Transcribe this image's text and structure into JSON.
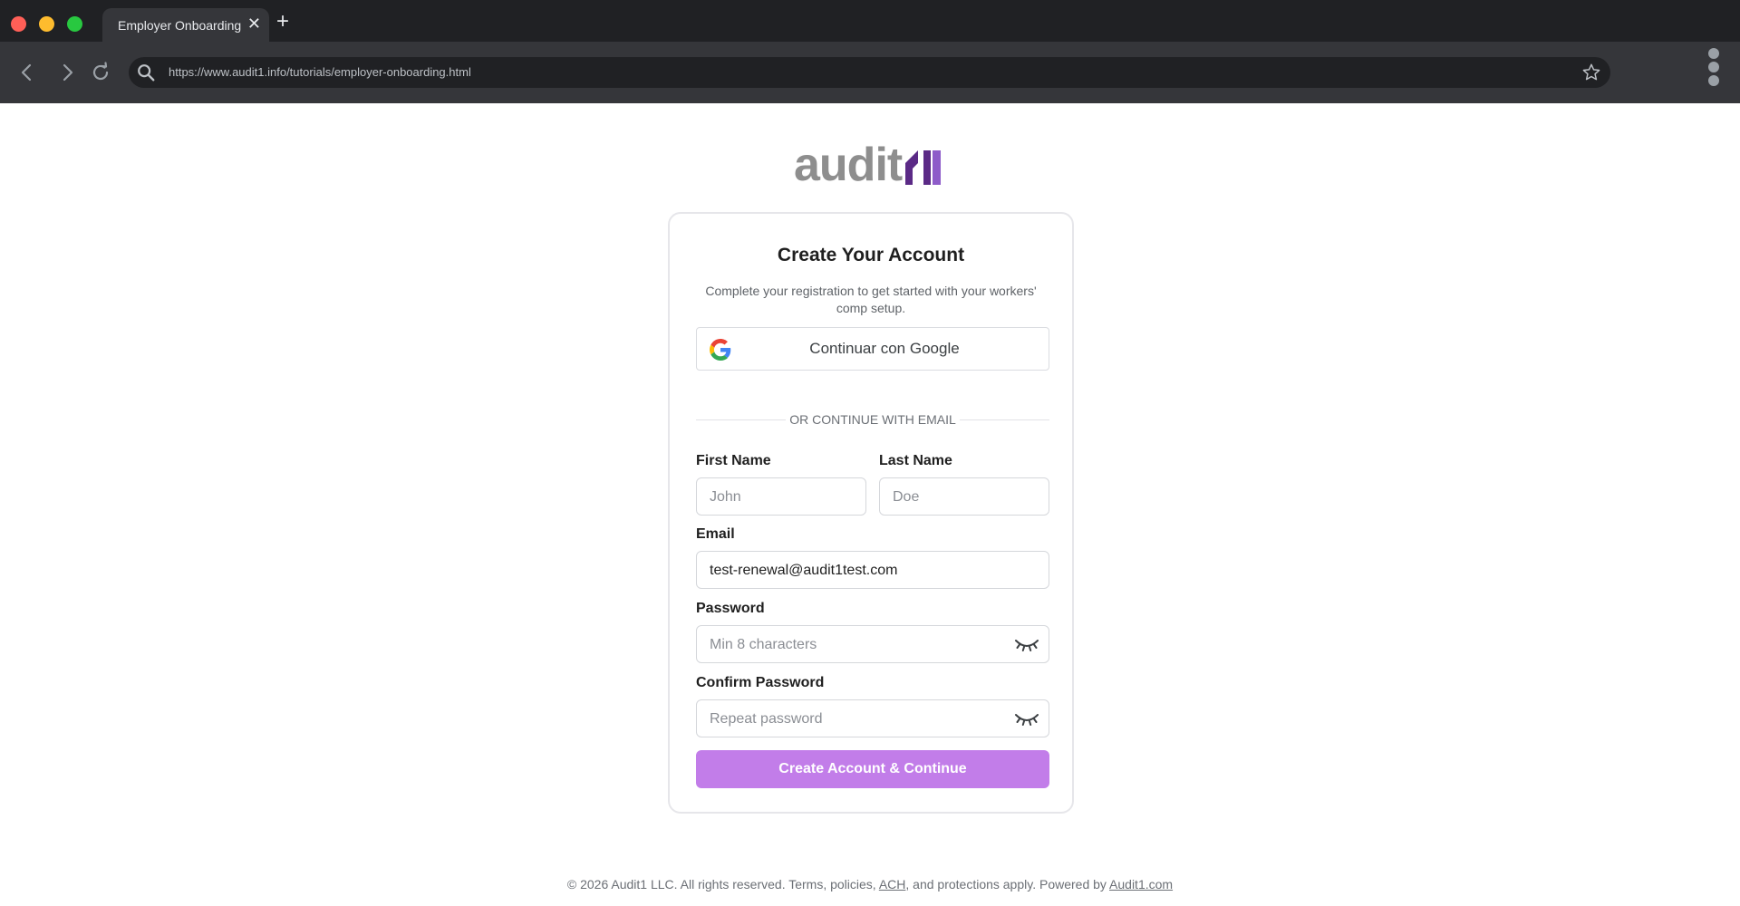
{
  "browser": {
    "tab_title": "Employer Onboarding",
    "tab_close": "✕",
    "new_tab": "+",
    "url": "https://www.audit1.info/tutorials/employer-onboarding.html"
  },
  "brand": {
    "logo_text": "audit",
    "logo_mark_colors": {
      "dark": "#5b2a86",
      "light": "#8e5cc9"
    }
  },
  "form": {
    "title": "Create Your Account",
    "subtitle": "Complete your registration to get started with your workers' comp setup.",
    "google_button": "Continuar con Google",
    "divider": "OR CONTINUE WITH EMAIL",
    "first_name": {
      "label": "First Name",
      "placeholder": "John",
      "value": ""
    },
    "last_name": {
      "label": "Last Name",
      "placeholder": "Doe",
      "value": ""
    },
    "email": {
      "label": "Email",
      "value": "test-renewal@audit1test.com"
    },
    "password": {
      "label": "Password",
      "placeholder": "Min 8 characters",
      "value": ""
    },
    "confirm_password": {
      "label": "Confirm Password",
      "placeholder": "Repeat password",
      "value": ""
    },
    "submit": "Create Account & Continue"
  },
  "footer": {
    "prefix": "© 2026 Audit1 LLC. All rights reserved. Terms, policies, ",
    "ach_link": "ACH",
    "middle": ", and protections apply. Powered by ",
    "powered_link": "Audit1.com"
  },
  "colors": {
    "accent": "#c27de9",
    "chrome_dark": "#202124",
    "chrome_toolbar": "#35363a"
  },
  "icons": {
    "back": "chevron-left-icon",
    "forward": "chevron-right-icon",
    "reload": "reload-icon",
    "search": "search-icon",
    "bookmark": "star-icon",
    "menu": "kebab-menu-icon",
    "google": "google-g-icon",
    "password_toggle": "eye-closed-icon"
  }
}
